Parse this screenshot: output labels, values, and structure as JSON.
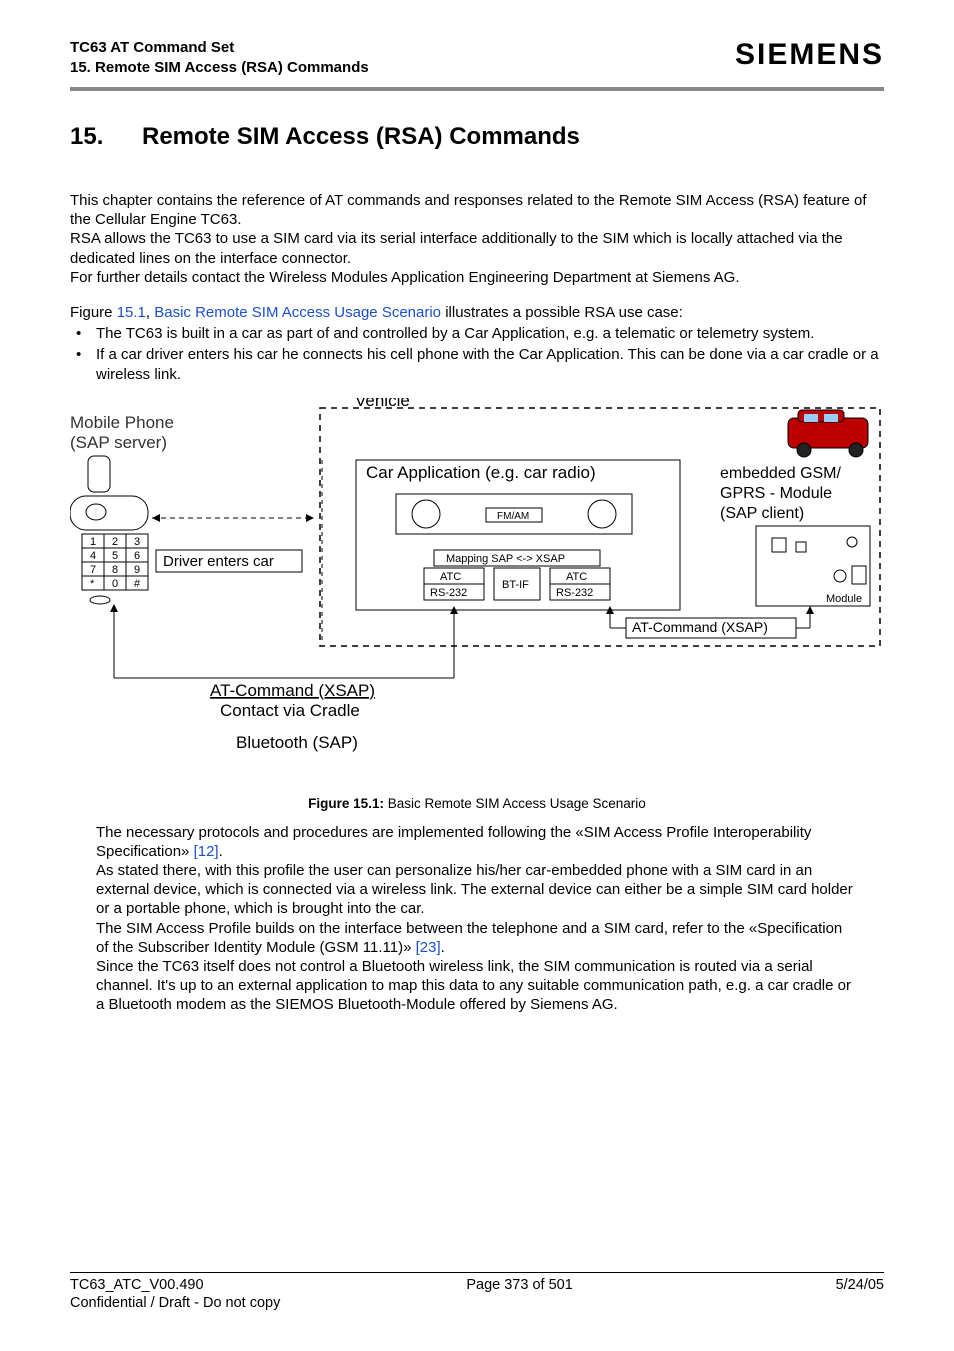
{
  "header": {
    "doc_title": "TC63 AT Command Set",
    "doc_sub": "15. Remote SIM Access (RSA) Commands",
    "brand": "SIEMENS"
  },
  "chapter": {
    "num": "15.",
    "title": "Remote SIM Access (RSA) Commands"
  },
  "intro": {
    "p1": "This chapter contains the reference of AT commands and responses related to the Remote SIM Access (RSA) feature of the Cellular Engine TC63.",
    "p2": "RSA allows the TC63 to use a SIM card via its serial interface additionally to the SIM which is locally attached via the dedicated lines on the interface connector.",
    "p3": "For further details contact the Wireless Modules Application Engineering Department at Siemens AG.",
    "fig_pre": "Figure ",
    "fig_ref": "15.1",
    "fig_sep": ", ",
    "fig_title_link": "Basic Remote SIM Access Usage Scenario",
    "fig_post": " illustrates a possible RSA use case:",
    "b1": "The TC63 is built in a car as part of and controlled by a Car Application, e.g. a telematic or telemetry system.",
    "b2": "If a car driver enters his car he connects his cell phone with the Car Application. This can be done via a car cradle or a wireless link."
  },
  "figure": {
    "mobile_phone": "Mobile Phone",
    "sap_server": "(SAP server)",
    "driver_enters_car": "Driver enters car",
    "vehicle": "Vehicle",
    "car_app": "Car Application (e.g. car radio)",
    "fm_am": "FM/AM",
    "mapping": "Mapping SAP <-> XSAP",
    "atc1": "ATC",
    "rs1": "RS-232",
    "btif": "BT-IF",
    "atc2": "ATC",
    "rs2": "RS-232",
    "embedded1": "embedded GSM/",
    "embedded2": "GPRS - Module",
    "sap_client": "(SAP client)",
    "module": "Module",
    "at_xsap1": "AT-Command (XSAP)",
    "at_xsap2": "AT-Command (XSAP)",
    "contact_cradle": "Contact via Cradle",
    "bluetooth_sap": "Bluetooth (SAP)",
    "keypad": [
      "1",
      "2",
      "3",
      "4",
      "5",
      "6",
      "7",
      "8",
      "9",
      "*",
      "0",
      "#"
    ]
  },
  "figcap": {
    "label": "Figure 15.1:",
    "text": " Basic Remote SIM Access Usage Scenario"
  },
  "post": {
    "p1a": "The necessary protocols and procedures are implemented following the «SIM Access Profile Interoperability Specification» ",
    "r12": "[12]",
    "dot": ".",
    "p2": "As stated there, with this profile the user can personalize his/her car-embedded phone with a SIM card in an external device, which is connected via a wireless link. The external device can either be a simple SIM card holder or a portable phone, which is brought into the car.",
    "p3a": "The SIM Access Profile builds on the interface between the telephone and a SIM card, refer to the «Specification of the Subscriber Identity Module (GSM 11.11)» ",
    "r23": "[23]",
    "p4": "Since the TC63 itself does not control a Bluetooth wireless link, the SIM communication is routed via a serial channel. It's up to an external application to map this data to any suitable communication path, e.g. a car cradle or a Bluetooth modem as the SIEMOS Bluetooth-Module offered by Siemens AG."
  },
  "footer": {
    "doc_id": "TC63_ATC_V00.490",
    "page": "Page 373 of 501",
    "date": "5/24/05",
    "conf": "Confidential / Draft - Do not copy"
  }
}
